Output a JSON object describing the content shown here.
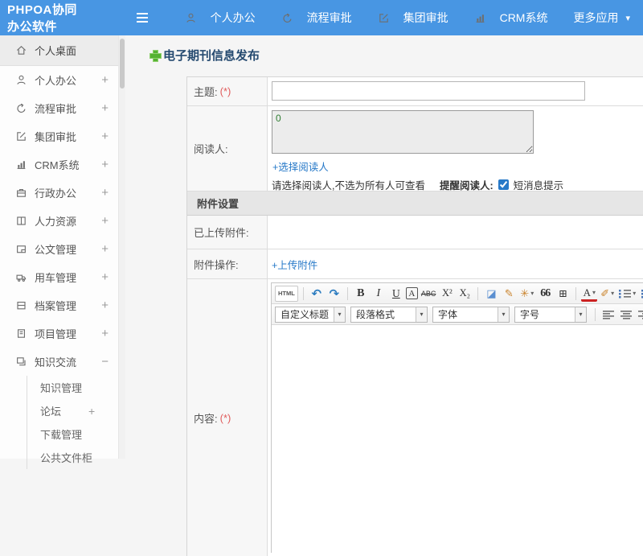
{
  "header": {
    "app_title": "PHPOA协同办公软件",
    "nav": [
      {
        "label": "个人办公",
        "icon": "user"
      },
      {
        "label": "流程审批",
        "icon": "process"
      },
      {
        "label": "集团审批",
        "icon": "edit"
      },
      {
        "label": "CRM系统",
        "icon": "chart"
      },
      {
        "label": "更多应用",
        "icon": "",
        "caret": "▾"
      }
    ]
  },
  "sidebar": {
    "items": [
      {
        "label": "个人桌面",
        "icon": "home",
        "expand_glyph": ""
      },
      {
        "label": "个人办公",
        "icon": "user",
        "expand_glyph": "+"
      },
      {
        "label": "流程审批",
        "icon": "process",
        "expand_glyph": "+"
      },
      {
        "label": "集团审批",
        "icon": "edit",
        "expand_glyph": "+"
      },
      {
        "label": "CRM系统",
        "icon": "chart",
        "expand_glyph": "+"
      },
      {
        "label": "行政办公",
        "icon": "briefcase",
        "expand_glyph": "+"
      },
      {
        "label": "人力资源",
        "icon": "book",
        "expand_glyph": "+"
      },
      {
        "label": "公文管理",
        "icon": "folder",
        "expand_glyph": "+"
      },
      {
        "label": "用车管理",
        "icon": "truck",
        "expand_glyph": "+"
      },
      {
        "label": "档案管理",
        "icon": "archive",
        "expand_glyph": "+"
      },
      {
        "label": "项目管理",
        "icon": "project",
        "expand_glyph": "+"
      },
      {
        "label": "知识交流",
        "icon": "knowledge",
        "expand_glyph": "−",
        "children": [
          {
            "label": "知识管理",
            "expand_glyph": ""
          },
          {
            "label": "论坛",
            "expand_glyph": "+"
          },
          {
            "label": "下载管理",
            "expand_glyph": ""
          },
          {
            "label": "公共文件柜",
            "expand_glyph": ""
          }
        ]
      }
    ]
  },
  "main": {
    "page_title": "电子期刊信息发布",
    "form": {
      "subject_label": "主题:",
      "required_mark": "(*)",
      "readers_label": "阅读人:",
      "readers_value": "0",
      "select_readers_link": "+选择阅读人",
      "readers_note": "请选择阅读人,不选为所有人可查看",
      "remind_label": "提醒阅读人:",
      "sms_label": "短消息提示",
      "attachment_section_title": "附件设置",
      "uploaded_label": "已上传附件:",
      "ops_label": "附件操作:",
      "upload_link": "+上传附件",
      "content_label": "内容:"
    },
    "editor": {
      "row1": [
        {
          "name": "html-source-button",
          "glyph": "HTML",
          "cls": "g-html"
        },
        {
          "name": "toolbar-separator",
          "type": "sep"
        },
        {
          "name": "undo-icon",
          "glyph": "↶",
          "cls": "c-blue"
        },
        {
          "name": "redo-icon",
          "glyph": "↷",
          "cls": "c-blue"
        },
        {
          "name": "toolbar-separator",
          "type": "sep"
        },
        {
          "name": "bold-icon",
          "glyph": "B",
          "cls": "g-bold"
        },
        {
          "name": "italic-icon",
          "glyph": "I",
          "cls": "g-italic"
        },
        {
          "name": "underline-icon",
          "glyph": "U",
          "cls": "g-underline"
        },
        {
          "name": "font-border-icon",
          "glyph": "A",
          "cls": "g-boxed"
        },
        {
          "name": "strikethrough-icon",
          "glyph": "ABC",
          "cls": "g-strike"
        },
        {
          "name": "superscript-icon",
          "glyph": "X²",
          "cls": "g-serif"
        },
        {
          "name": "subscript-icon",
          "glyph": "X₂",
          "cls": "g-serif"
        },
        {
          "name": "toolbar-separator",
          "type": "sep"
        },
        {
          "name": "eraser-icon",
          "glyph": "◪",
          "cls": "c-eraser"
        },
        {
          "name": "format-painter-icon",
          "glyph": "✎",
          "cls": "c-orange"
        },
        {
          "name": "autotypeset-icon",
          "glyph": "✳",
          "cls": "c-orange",
          "dropdown": true
        },
        {
          "name": "blockquote-icon",
          "glyph": "66",
          "cls": "g-quote"
        },
        {
          "name": "insert-table-icon",
          "glyph": "⊞",
          "cls": "g-serif"
        },
        {
          "name": "toolbar-separator",
          "type": "sep"
        },
        {
          "name": "font-color-icon",
          "glyph": "A",
          "cls": "g-fontcolor",
          "dropdown": true
        },
        {
          "name": "highlight-color-icon",
          "glyph": "✐",
          "cls": "c-orange",
          "dropdown": true
        },
        {
          "name": "ordered-list-icon",
          "type": "css",
          "cls": "icon-ol",
          "dropdown": true
        },
        {
          "name": "unordered-list-icon",
          "type": "css",
          "cls": "icon-ul"
        }
      ],
      "row2_selects": [
        {
          "name": "custom-title-select",
          "label": "自定义标题",
          "cls": "w1"
        },
        {
          "name": "paragraph-format-select",
          "label": "段落格式",
          "cls": "w2"
        },
        {
          "name": "font-family-select",
          "label": "字体",
          "cls": "w3"
        },
        {
          "name": "font-size-select",
          "label": "字号",
          "cls": "w4"
        }
      ],
      "row2_icons": [
        {
          "name": "toolbar-separator",
          "type": "sep"
        },
        {
          "name": "align-left-icon",
          "type": "css",
          "cls": "icon-al"
        },
        {
          "name": "align-center-icon",
          "type": "css",
          "cls": "icon-ac"
        },
        {
          "name": "align-right-icon",
          "type": "css",
          "cls": "icon-ar"
        },
        {
          "name": "justify-icon",
          "type": "css",
          "cls": "icon-aj"
        },
        {
          "name": "link-icon",
          "type": "css",
          "cls": "icon-chain"
        },
        {
          "name": "unlink-icon",
          "type": "css",
          "cls": "icon-unchain"
        },
        {
          "name": "insert-image-icon",
          "type": "css",
          "cls": "icon-img"
        },
        {
          "name": "insert-map-icon",
          "type": "css",
          "cls": "icon-img2"
        }
      ]
    }
  },
  "colors": {
    "header_blue": "#4896e3",
    "link_blue": "#2779c8",
    "required_red": "#e05c5c",
    "title_navy": "#254a70",
    "reader_count_green": "#2f7d32"
  }
}
